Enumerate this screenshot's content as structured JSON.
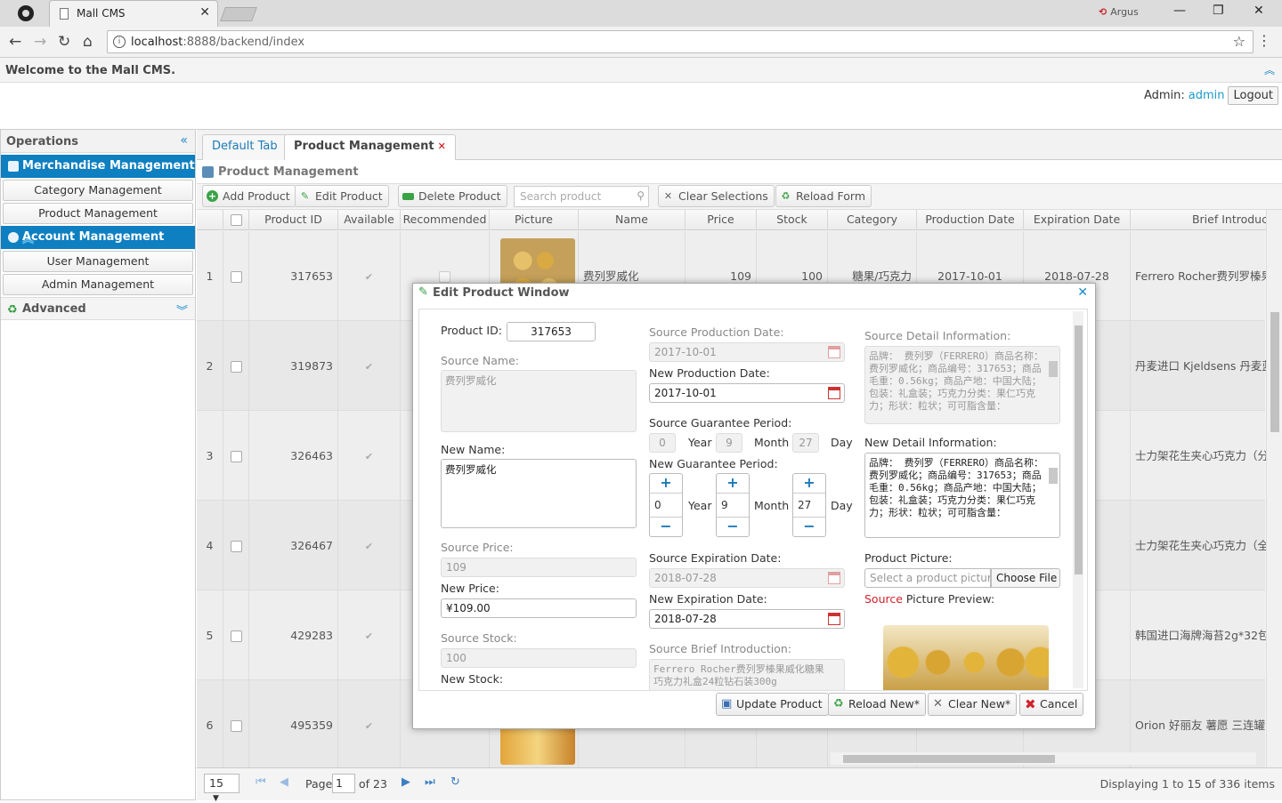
{
  "browser": {
    "tab_title": "Mall CMS",
    "url_host": "localhost",
    "url_path": ":8888/backend/index",
    "extension": "Argus"
  },
  "header": {
    "welcome": "Welcome to the Mall CMS.",
    "admin_label": "Admin:",
    "admin_name": "admin",
    "logout": "Logout"
  },
  "sidebar": {
    "title": "Operations",
    "groups": [
      {
        "label": "Merchandise Management",
        "items": [
          "Category Management",
          "Product Management"
        ]
      },
      {
        "label": "Account Management",
        "items": [
          "User Management",
          "Admin Management"
        ]
      }
    ],
    "advanced": "Advanced"
  },
  "tabs": {
    "default": "Default Tab",
    "active": "Product Management"
  },
  "panel_title": "Product Management",
  "toolbar": {
    "add": "Add Product",
    "edit": "Edit Product",
    "delete": "Delete Product",
    "search_placeholder": "Search product",
    "clear": "Clear Selections",
    "reload": "Reload Form"
  },
  "grid": {
    "columns": [
      "Product ID",
      "Available",
      "Recommended",
      "Picture",
      "Name",
      "Price",
      "Stock",
      "Category",
      "Production Date",
      "Expiration Date",
      "Brief Introductio"
    ],
    "rows": [
      {
        "no": "1",
        "id": "317653",
        "name": "费列罗威化",
        "price": "109",
        "stock": "100",
        "category": "糖果/巧克力",
        "prod": "2017-10-01",
        "exp": "2018-07-28",
        "intro": "Ferrero Rocher费列罗榛果"
      },
      {
        "no": "2",
        "id": "319873",
        "name": "",
        "price": "",
        "stock": "",
        "category": "",
        "prod": "",
        "exp": "21",
        "intro": "丹麦进口 Kjeldsens 丹麦蓝"
      },
      {
        "no": "3",
        "id": "326463",
        "name": "",
        "price": "",
        "stock": "",
        "category": "",
        "prod": "",
        "exp": "",
        "intro": "士力架花生夹心巧克力（分"
      },
      {
        "no": "4",
        "id": "326467",
        "name": "",
        "price": "",
        "stock": "",
        "category": "",
        "prod": "",
        "exp": "",
        "intro": "士力架花生夹心巧克力（全"
      },
      {
        "no": "5",
        "id": "429283",
        "name": "",
        "price": "",
        "stock": "",
        "category": "",
        "prod": "",
        "exp": "01",
        "intro": "韩国进口海牌海苔2g*32包"
      },
      {
        "no": "6",
        "id": "495359",
        "name": "",
        "price": "",
        "stock": "",
        "category": "",
        "prod": "",
        "exp": "01",
        "intro": "Orion 好丽友 薯愿 三连罐"
      }
    ]
  },
  "pager": {
    "page_size": "15",
    "page_label": "Page",
    "page": "1",
    "of": "of 23",
    "displaying": "Displaying 1 to 15 of 336 items"
  },
  "dialog": {
    "title": "Edit Product Window",
    "product_id_label": "Product ID:",
    "product_id": "317653",
    "source_name_label": "Source Name:",
    "source_name": "费列罗威化",
    "new_name_label": "New Name:",
    "new_name": "费列罗威化",
    "source_price_label": "Source Price:",
    "source_price": "109",
    "new_price_label": "New Price:",
    "new_price": "¥109.00",
    "source_stock_label": "Source Stock:",
    "source_stock": "100",
    "new_stock_label": "New Stock:",
    "source_prod_label": "Source Production Date:",
    "source_prod": "2017-10-01",
    "new_prod_label": "New Production Date:",
    "new_prod": "2017-10-01",
    "source_guar_label": "Source Guarantee Period:",
    "source_guar": {
      "year": "0",
      "month": "9",
      "day": "27"
    },
    "new_guar_label": "New Guarantee Period:",
    "new_guar": {
      "year": "0",
      "month": "9",
      "day": "27"
    },
    "unit_year": "Year",
    "unit_month": "Month",
    "unit_day": "Day",
    "source_exp_label": "Source Expiration Date:",
    "source_exp": "2018-07-28",
    "new_exp_label": "New Expiration Date:",
    "new_exp": "2018-07-28",
    "source_brief_label": "Source Brief Introduction:",
    "source_brief": "Ferrero Rocher费列罗榛果威化糖果巧克力礼盒24粒钻石装300g",
    "source_detail_label": "Source Detail Information:",
    "source_detail": "品牌： 费列罗（FERRERO）商品名称：费列罗威化；商品编号：317653；商品毛重：0.56kg；商品产地：中国大陆；包装：礼盒装；巧克力分类：果仁巧克力；形状：粒状；可可脂含量：",
    "new_detail_label": "New Detail Information:",
    "new_detail": "品牌： 费列罗（FERRERO）商品名称：费列罗威化；商品编号：317653；商品毛重：0.56kg；商品产地：中国大陆；包装：礼盒装；巧克力分类：果仁巧克力；形状：粒状；可可脂含量：",
    "picture_label": "Product Picture:",
    "picture_placeholder": "Select a product picture",
    "choose_file": "Choose File",
    "preview_label_source": "Source",
    "preview_label_rest": " Picture Preview:",
    "buttons": {
      "update": "Update Product",
      "reload": "Reload New*",
      "clear": "Clear New*",
      "cancel": "Cancel"
    }
  },
  "colors": {
    "accent": "#0e7fc1",
    "link": "#1b9ac9",
    "cancel": "#d0202a",
    "ok": "#2f9a3a"
  }
}
